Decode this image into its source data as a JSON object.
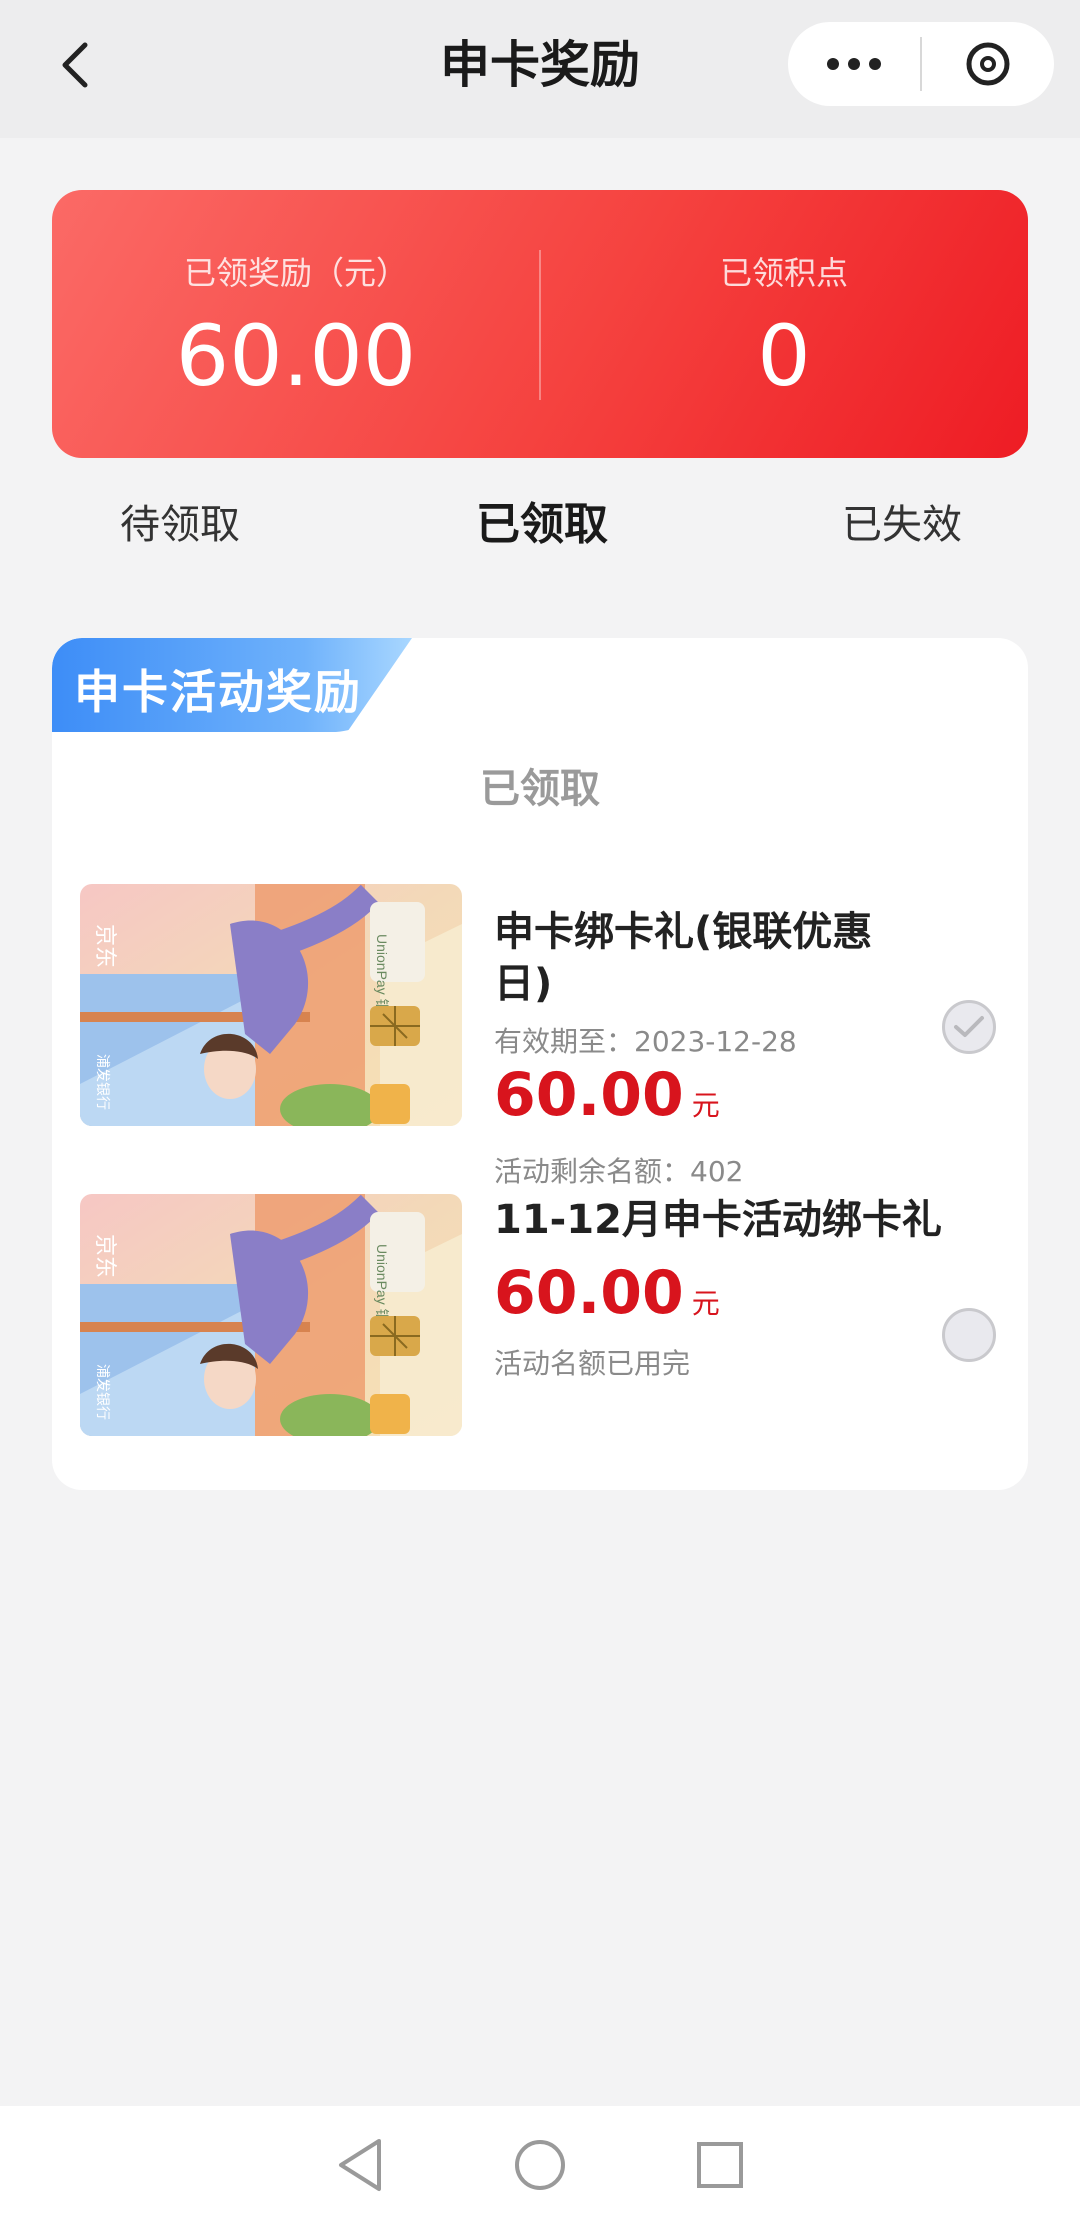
{
  "header": {
    "title": "申卡奖励",
    "back_icon": "chevron-left-icon",
    "more_icon": "more-dots-icon",
    "close_icon": "close-circle-icon"
  },
  "summary": {
    "reward_label": "已领奖励（元）",
    "reward_value": "60.00",
    "points_label": "已领积点",
    "points_value": "0",
    "gradient_colors": [
      "#fb6a66",
      "#ee1c24"
    ]
  },
  "tabs": [
    {
      "label": "待领取",
      "active": false
    },
    {
      "label": "已领取",
      "active": true
    },
    {
      "label": "已失效",
      "active": false
    }
  ],
  "rewards_section": {
    "ribbon_title": "申卡活动奖励",
    "status_title": "已领取",
    "items": [
      {
        "title": "申卡绑卡礼(银联优惠日)",
        "valid_until": "有效期至：2023-12-28",
        "amount": "60.00",
        "unit": "元",
        "note": "活动剩余名额：402",
        "checked": true
      },
      {
        "title": "11-12月申卡活动绑卡礼",
        "amount": "60.00",
        "unit": "元",
        "note": "活动名额已用完",
        "checked": false
      }
    ]
  },
  "card_image": {
    "brand_text": "京东",
    "bank_text": "浦发银行",
    "union_text": "UnionPay 银联"
  },
  "accent_red": "#d8141d",
  "navbar": {
    "back_icon": "triangle-back-icon",
    "home_icon": "circle-home-icon",
    "recents_icon": "square-recents-icon"
  }
}
